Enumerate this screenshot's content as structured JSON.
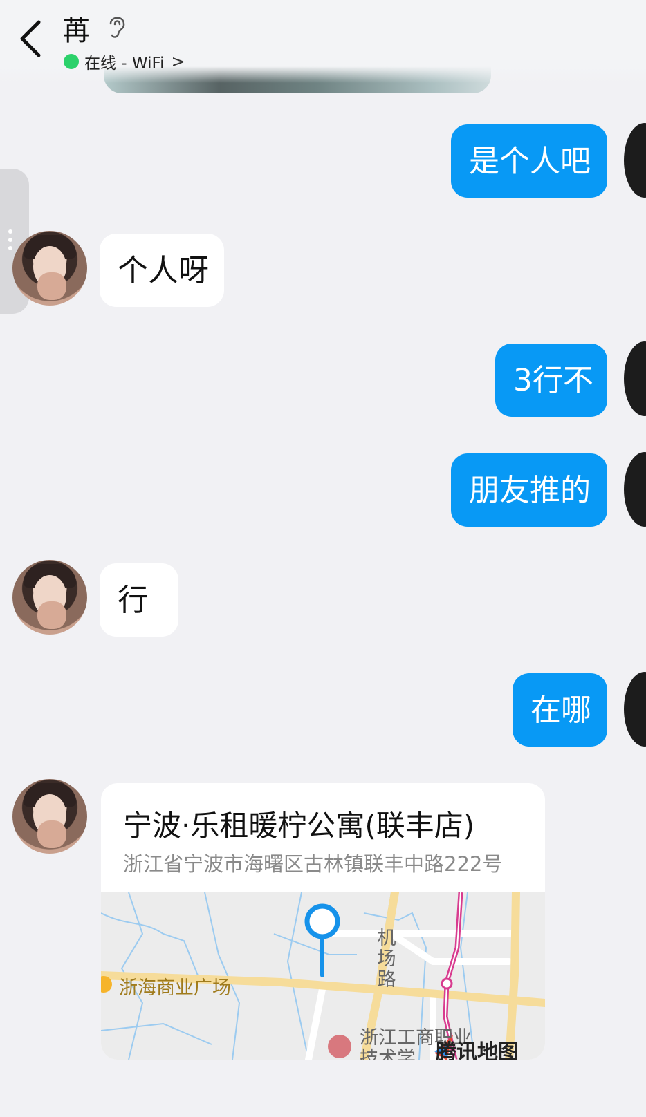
{
  "header": {
    "title": "苒",
    "status": "在线 - WiFi",
    "status_chevron": ">"
  },
  "messages": [
    {
      "side": "out",
      "text": "是个人吧"
    },
    {
      "side": "in",
      "text": "个人呀"
    },
    {
      "side": "out",
      "text": "3行不"
    },
    {
      "side": "out",
      "text": "朋友推的"
    },
    {
      "side": "in",
      "text": "行"
    },
    {
      "side": "out",
      "text": "在哪"
    }
  ],
  "location": {
    "name": "宁波·乐租暖柠公寓(联丰店)",
    "address": "浙江省宁波市海曙区古林镇联丰中路222号",
    "map": {
      "poi_1": "浙海商业广场",
      "road": [
        "机",
        "场",
        "路"
      ],
      "poi_2_line1": "浙江工商职业",
      "poi_2_line2": "技术学",
      "provider": "腾讯地图"
    }
  },
  "colors": {
    "outgoing_bubble": "#0899f5",
    "incoming_bubble": "#ffffff",
    "background": "#f1f1f4",
    "online_dot": "#2bd16a"
  },
  "icons": [
    "back-arrow-icon",
    "ear-icon",
    "more-dots-icon",
    "map-pin-icon"
  ]
}
